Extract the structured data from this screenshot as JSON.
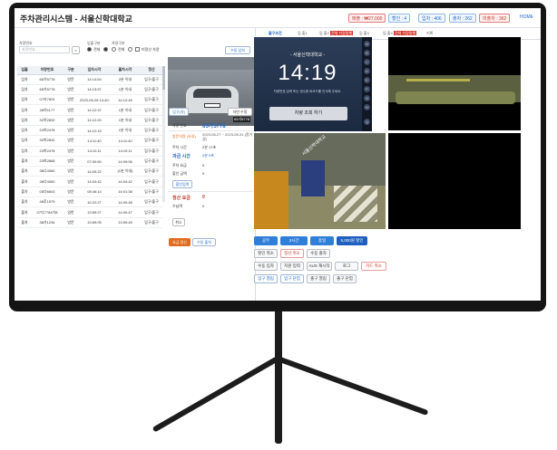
{
  "app": {
    "title": "주차관리시스템 - 서울신학대학교"
  },
  "header": {
    "badges": [
      {
        "label": "매출 : ₩27,000",
        "style": "red"
      },
      {
        "label": "할인 : 4",
        "style": "blue"
      },
      {
        "label": "입차 : 406",
        "style": "blue"
      },
      {
        "label": "출차 : 262",
        "style": "blue"
      },
      {
        "label": "미출차 : 362",
        "style": "red"
      }
    ],
    "right_link": "HOME"
  },
  "filters": {
    "plate_label": "차량번호",
    "plate_placeholder": "차량번호",
    "clear_label": "×",
    "inout_label": "입출구분",
    "type_label": "차량구분",
    "options": [
      "전체",
      "전체"
    ],
    "checkbox_label": "미정산 차량",
    "manual_in_button": "수동 입차"
  },
  "table": {
    "headers": [
      "입출",
      "차량번호",
      "구분",
      "입차시각",
      "출차시각",
      "정산"
    ],
    "rows": [
      [
        "입차",
        "65가5778",
        "방문",
        "14:14:54",
        "2분 이내",
        "입구/출구"
      ],
      [
        "입차",
        "65가5778",
        "방문",
        "14:13:57",
        "1분 이내",
        "입구/출구"
      ],
      [
        "입차",
        "07러7824",
        "방문",
        "2023-06-28 14:40:49",
        "14:12:49",
        "입구/출구"
      ],
      [
        "입차",
        "28하1177",
        "방문",
        "14:12:37",
        "1분 이내",
        "입구/출구"
      ],
      [
        "입차",
        "32허2832",
        "방문",
        "14:12:20",
        "1분 이내",
        "입구/출구"
      ],
      [
        "입차",
        "23허2478",
        "방문",
        "14:12:15",
        "1분 이내",
        "입구/출구"
      ],
      [
        "입차",
        "32허2832",
        "방문",
        "14:11:40",
        "14:11:40",
        "입구/출구"
      ],
      [
        "입차",
        "23허2478",
        "방문",
        "14:10:11",
        "14:10:11",
        "입구/출구"
      ],
      [
        "출차",
        "23허2868",
        "방문",
        "07:00:50",
        "14:09:06",
        "입구/출구"
      ],
      [
        "출차",
        "38너4060",
        "방문",
        "14:05:22",
        "(1분 이내)",
        "입구/출구"
      ],
      [
        "출차",
        "38너4060",
        "방문",
        "14:04:42",
        "14:04:42",
        "입구/출구"
      ],
      [
        "출차",
        "05다6843",
        "방문",
        "08:46:14",
        "14:01:38",
        "입구/출구"
      ],
      [
        "출차",
        "48루1579",
        "방문",
        "10:22:27",
        "14:00:48",
        "입구/출구"
      ],
      [
        "출차",
        "07다7784가8",
        "일반",
        "13:59:27",
        "14:00:47",
        "입구/출구"
      ],
      [
        "출차",
        "38가1234",
        "방문",
        "13:59:05",
        "13:59:45",
        "입구/출구"
      ]
    ]
  },
  "photo": {
    "overlay_label": "65가5778",
    "in_button": "입구(차)",
    "edit_button": "차번 수정"
  },
  "detail": {
    "rows": [
      {
        "key": "차량 번호",
        "value": "65가5778"
      },
      {
        "key": "방문차량 (유료)",
        "value": "2023-06-27 ~ 2023-08-31 (정기권)"
      },
      {
        "key": "주차 시간",
        "value": "2분 17초"
      },
      {
        "key": "과금 시간",
        "value": "0분 0초"
      },
      {
        "key": "주차 요금",
        "value": "0"
      },
      {
        "key": "할인 금액",
        "value": "0"
      }
    ],
    "discount_button": "할인입력",
    "settle_label": "정산 요금",
    "settle_value": "0",
    "received_label": "수납액",
    "received_value": "0",
    "cancel_button": "취소",
    "pay_button": "요금 정산",
    "manual_out_button": "수동 출차"
  },
  "tabs": [
    "출구조건",
    "입 출1",
    "입 출2",
    "입 출3",
    "입 출4",
    "기록"
  ],
  "tab_tags": [
    "전체 차량통행",
    "전체 차량통행"
  ],
  "kiosk": {
    "title": "- 서울신학대학교 -",
    "time": "14:19",
    "subtitle": "차량번호 입력 또는 영수증 바코드를 인식해 주세요.",
    "button": "차량 조회 하기",
    "side_icons": [
      "N",
      "B",
      "C",
      "D",
      "E",
      "F",
      "G",
      "H",
      "Q"
    ]
  },
  "camera_labels": {
    "sign": "서울신학대학교"
  },
  "controls": {
    "row1": [
      "공무",
      "3시간",
      "종일",
      "5,000원 할인"
    ],
    "row2": [
      "할인 취소",
      "정산 취소",
      "수동 출차"
    ],
    "row3": [
      "수동 입차",
      "지원 입력",
      "AUX 재시작",
      "로그",
      "카드 취소"
    ],
    "row4": [
      "입구 열림",
      "입구 닫힘",
      "출구 열림",
      "출구 닫힘"
    ]
  },
  "colors": {
    "primary": "#1f66c7",
    "danger": "#d9342b",
    "pay": "#e06b1f",
    "frame": "#141414"
  }
}
